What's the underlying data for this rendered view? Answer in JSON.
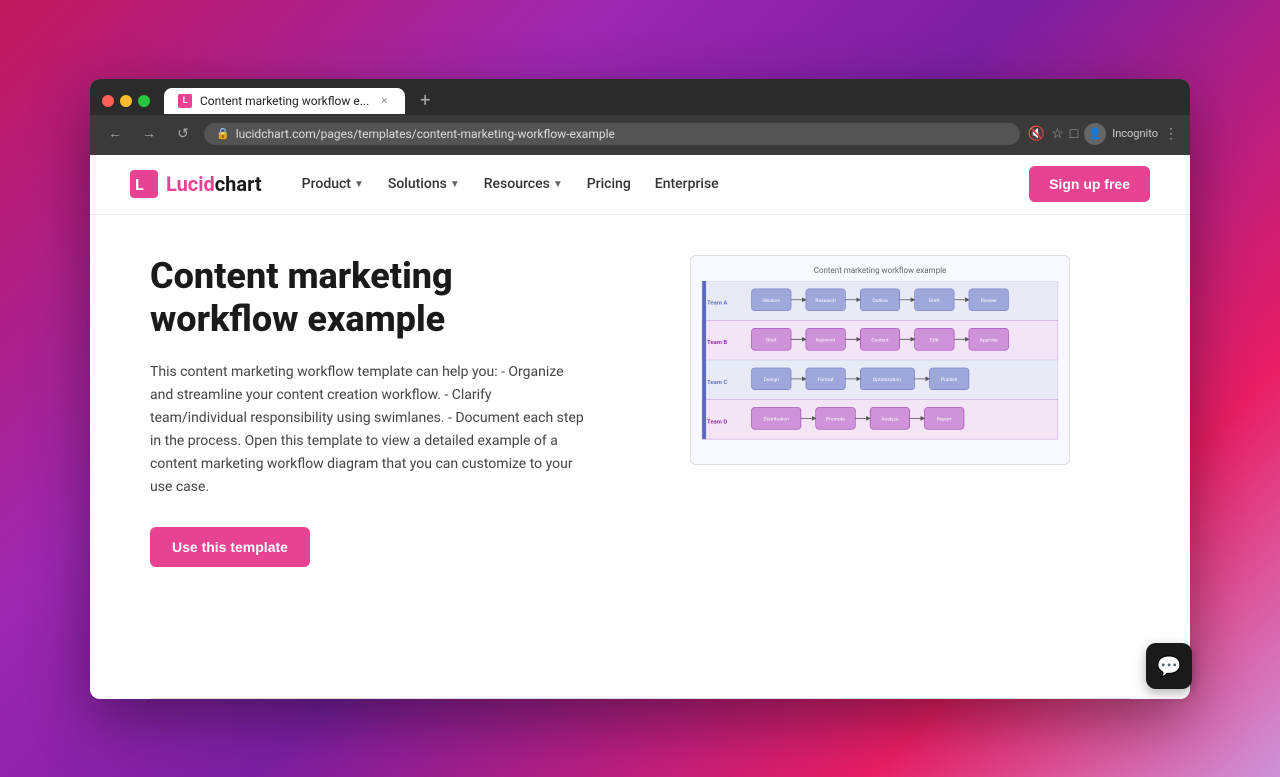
{
  "browser": {
    "tab_title": "Content marketing workflow e...",
    "tab_close": "×",
    "tab_new": "+",
    "address": "lucidchart.com/pages/templates/content-marketing-workflow-example",
    "incognito_label": "Incognito",
    "nav_back": "←",
    "nav_forward": "→",
    "nav_refresh": "↺"
  },
  "nav": {
    "logo_text": "Lucidchart",
    "product_label": "Product",
    "solutions_label": "Solutions",
    "resources_label": "Resources",
    "pricing_label": "Pricing",
    "enterprise_label": "Enterprise",
    "signup_label": "Sign up free"
  },
  "main": {
    "title": "Content marketing workflow example",
    "description": "This content marketing workflow template can help you: - Organize and streamline your content creation workflow. - Clarify team/individual responsibility using swimlanes. - Document each step in the process. Open this template to view a detailed example of a content marketing workflow diagram that you can customize to your use case.",
    "cta_label": "Use this template",
    "diagram_title": "Content marketing workflow example"
  },
  "chat": {
    "icon": "💬"
  }
}
